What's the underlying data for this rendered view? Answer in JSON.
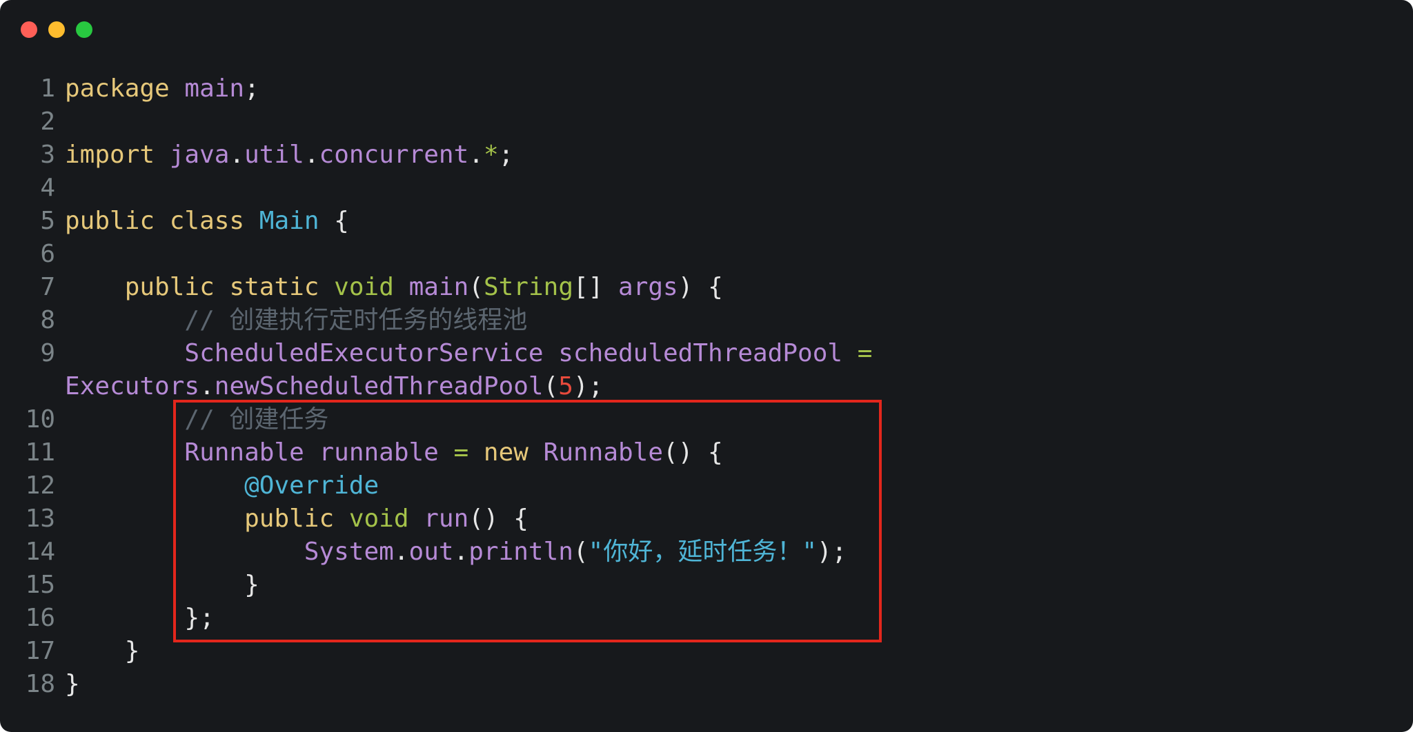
{
  "window": {
    "controls": [
      "close",
      "minimize",
      "maximize"
    ]
  },
  "code": {
    "language": "java",
    "lines": [
      {
        "n": "1",
        "tokens": [
          [
            "kw",
            "package"
          ],
          [
            "pun",
            " "
          ],
          [
            "ty",
            "main"
          ],
          [
            "pun",
            ";"
          ]
        ]
      },
      {
        "n": "2",
        "tokens": []
      },
      {
        "n": "3",
        "tokens": [
          [
            "kw",
            "import"
          ],
          [
            "pun",
            " "
          ],
          [
            "ty",
            "java"
          ],
          [
            "pun",
            "."
          ],
          [
            "ty",
            "util"
          ],
          [
            "pun",
            "."
          ],
          [
            "ty",
            "concurrent"
          ],
          [
            "pun",
            "."
          ],
          [
            "op",
            "*"
          ],
          [
            "pun",
            ";"
          ]
        ]
      },
      {
        "n": "4",
        "tokens": []
      },
      {
        "n": "5",
        "tokens": [
          [
            "kw",
            "public"
          ],
          [
            "pun",
            " "
          ],
          [
            "kw",
            "class"
          ],
          [
            "pun",
            " "
          ],
          [
            "cls",
            "Main"
          ],
          [
            "pun",
            " {"
          ]
        ]
      },
      {
        "n": "6",
        "tokens": []
      },
      {
        "n": "7",
        "tokens": [
          [
            "pun",
            "    "
          ],
          [
            "kw",
            "public"
          ],
          [
            "pun",
            " "
          ],
          [
            "kw",
            "static"
          ],
          [
            "pun",
            " "
          ],
          [
            "kw2",
            "void"
          ],
          [
            "pun",
            " "
          ],
          [
            "ty",
            "main"
          ],
          [
            "pun",
            "("
          ],
          [
            "kw2",
            "String"
          ],
          [
            "pun",
            "[] "
          ],
          [
            "ty",
            "args"
          ],
          [
            "pun",
            ") {"
          ]
        ]
      },
      {
        "n": "8",
        "tokens": [
          [
            "pun",
            "        "
          ],
          [
            "cm",
            "// 创建执行定时任务的线程池"
          ]
        ]
      },
      {
        "n": "9",
        "tokens": [
          [
            "pun",
            "        "
          ],
          [
            "ty",
            "ScheduledExecutorService"
          ],
          [
            "pun",
            " "
          ],
          [
            "ty",
            "scheduledThreadPool"
          ],
          [
            "pun",
            " "
          ],
          [
            "op",
            "="
          ]
        ]
      },
      {
        "n": "",
        "tokens": [
          [
            "ty",
            "Executors"
          ],
          [
            "pun",
            "."
          ],
          [
            "ty",
            "newScheduledThreadPool"
          ],
          [
            "pun",
            "("
          ],
          [
            "num",
            "5"
          ],
          [
            "pun",
            ");"
          ]
        ]
      },
      {
        "n": "10",
        "tokens": [
          [
            "pun",
            "        "
          ],
          [
            "cm",
            "// 创建任务"
          ]
        ]
      },
      {
        "n": "11",
        "tokens": [
          [
            "pun",
            "        "
          ],
          [
            "ty",
            "Runnable"
          ],
          [
            "pun",
            " "
          ],
          [
            "ty",
            "runnable"
          ],
          [
            "pun",
            " "
          ],
          [
            "op",
            "="
          ],
          [
            "pun",
            " "
          ],
          [
            "kw",
            "new"
          ],
          [
            "pun",
            " "
          ],
          [
            "ty",
            "Runnable"
          ],
          [
            "pun",
            "() {"
          ]
        ]
      },
      {
        "n": "12",
        "tokens": [
          [
            "pun",
            "            "
          ],
          [
            "ann",
            "@Override"
          ]
        ]
      },
      {
        "n": "13",
        "tokens": [
          [
            "pun",
            "            "
          ],
          [
            "kw",
            "public"
          ],
          [
            "pun",
            " "
          ],
          [
            "kw2",
            "void"
          ],
          [
            "pun",
            " "
          ],
          [
            "ty",
            "run"
          ],
          [
            "pun",
            "() {"
          ]
        ]
      },
      {
        "n": "14",
        "tokens": [
          [
            "pun",
            "                "
          ],
          [
            "ty",
            "System"
          ],
          [
            "pun",
            "."
          ],
          [
            "ty",
            "out"
          ],
          [
            "pun",
            "."
          ],
          [
            "ty",
            "println"
          ],
          [
            "pun",
            "("
          ],
          [
            "str",
            "\"你好，延时任务！\""
          ],
          [
            "pun",
            ");"
          ]
        ]
      },
      {
        "n": "15",
        "tokens": [
          [
            "pun",
            "            }"
          ]
        ]
      },
      {
        "n": "16",
        "tokens": [
          [
            "pun",
            "        };"
          ]
        ]
      },
      {
        "n": "17",
        "tokens": [
          [
            "pun",
            "    }"
          ]
        ]
      },
      {
        "n": "18",
        "tokens": [
          [
            "pun",
            "}"
          ]
        ]
      }
    ]
  },
  "highlight": {
    "color": "#e3261c",
    "from_line": "10",
    "to_line": "16"
  }
}
